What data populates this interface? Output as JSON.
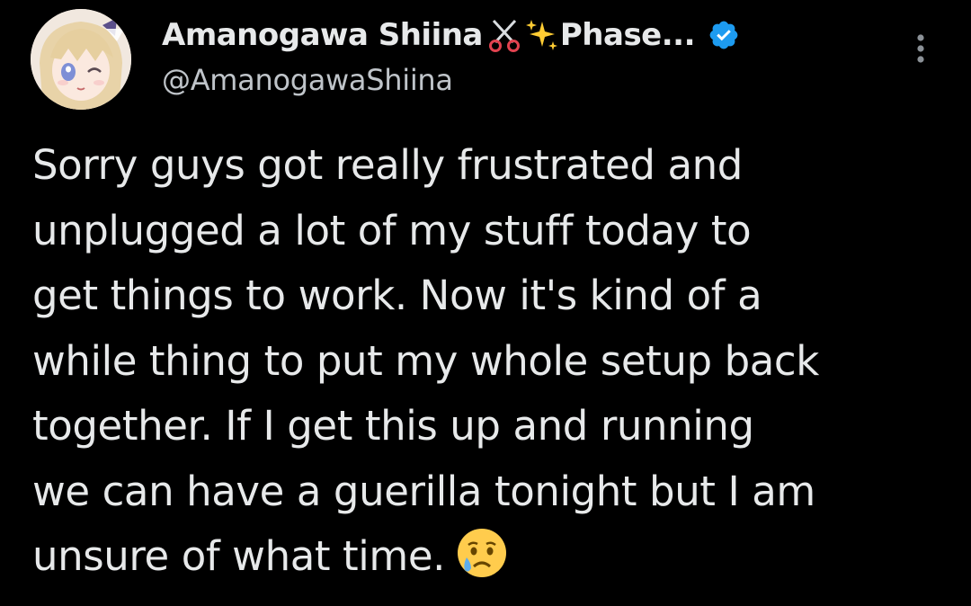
{
  "tweet": {
    "display_name": "Amanogawa Shiina",
    "name_suffix": "Phase...",
    "handle": "@AmanogawaShiina",
    "body": "Sorry guys got really frustrated and\nunplugged a lot of my stuff today to\nget things to work. Now it's kind of a\nwhile thing to put my whole setup back\ntogether. If I get this up and running\nwe can have a guerilla tonight but I am\nunsure of what time.",
    "name_emojis": [
      "scissors-icon",
      "sparkles-icon"
    ],
    "trailing_emoji": "crying-face-icon",
    "verified": true
  },
  "colors": {
    "background": "#000000",
    "text": "#e7e9ea",
    "secondary_text": "#bfc4c9",
    "verified_blue": "#1d9bf0"
  }
}
